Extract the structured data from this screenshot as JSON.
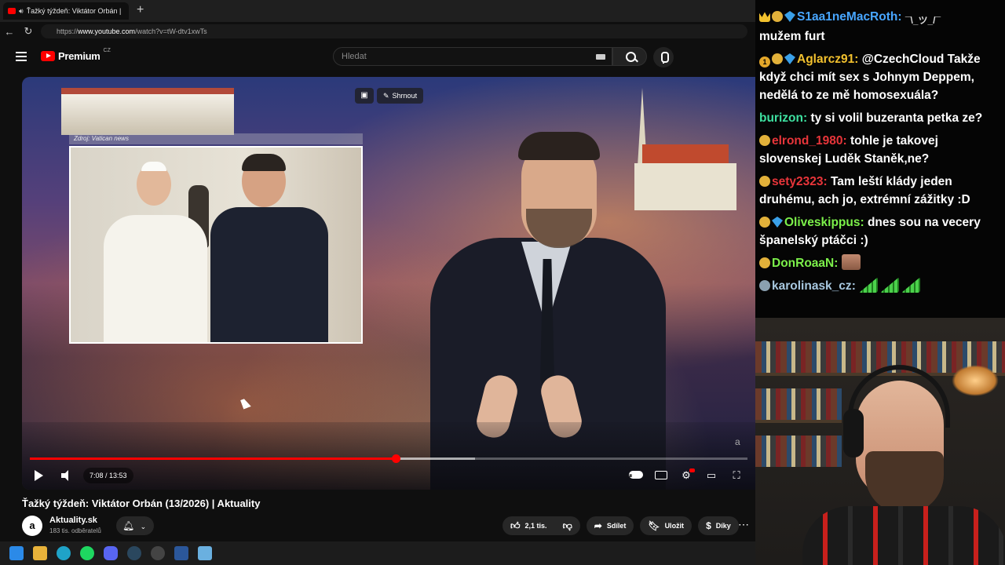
{
  "browser": {
    "tab_title": "Ťažký týždeň: Viktátor Orbán |",
    "url_prefix": "https://",
    "url_domain": "www.youtube.com",
    "url_path": "/watch?v=tW-dtv1xwTs"
  },
  "youtube": {
    "logo_text": "Premium",
    "logo_region": "CZ",
    "search_placeholder": "Hledat"
  },
  "player": {
    "summary_label": "Shrnout",
    "inset_source": "Zdroj: Vatican news",
    "current_time": "7:08",
    "duration": "13:53",
    "time_display": "7:08 / 13:53",
    "progress_fraction": 0.51,
    "buffer_fraction": 0.62,
    "watermark": "a"
  },
  "video": {
    "title": "Ťažký týždeň: Viktátor Orbán (13/2026) | Aktuality",
    "channel_name": "Aktuality.sk",
    "channel_initial": "a",
    "subscribers": "183 tis. odběratelů",
    "likes": "2,1 tis.",
    "share_label": "Sdílet",
    "save_label": "Uložit",
    "thanks_label": "Díky"
  },
  "chat": {
    "messages": [
      {
        "user": "S1aa1neMacRoth",
        "color": "#48a6ff",
        "badges": [
          "crown",
          "hand",
          "gem"
        ],
        "text": "mužem furt",
        "emote": "shrug"
      },
      {
        "user": "Aglarcz91",
        "color": "#f2c12e",
        "badges": [
          "coin",
          "hand",
          "gem"
        ],
        "text": "@CzechCloud Takže když chci mít sex s Johnym Deppem, nedělá to ze mě homosexuála?"
      },
      {
        "user": "burizon",
        "color": "#3ee0a0",
        "badges": [],
        "text": "ty si volil buzeranta petka ze?"
      },
      {
        "user": "elrond_1980",
        "color": "#e8353a",
        "badges": [
          "hand"
        ],
        "text": "tohle je takovej slovenskej Luděk Staněk,ne?"
      },
      {
        "user": "sety2323",
        "color": "#e8353a",
        "badges": [
          "hand"
        ],
        "text": "Tam leští klády jeden druhému, ach jo, extrémní zážitky :D"
      },
      {
        "user": "Oliveskippus",
        "color": "#7cf04a",
        "badges": [
          "hand",
          "gem"
        ],
        "text": "dnes sou na vecery španelský ptáčci :)"
      },
      {
        "user": "DonRoaaN",
        "color": "#7cf04a",
        "badges": [
          "hand"
        ],
        "text": "",
        "emote": "face"
      },
      {
        "user": "karolinask_cz",
        "color": "#a8c8e0",
        "badges": [
          "grey"
        ],
        "text": "",
        "emote": "bars3"
      }
    ],
    "emote_shrug_text": "¯\\_ツ_/¯"
  },
  "colors": {
    "progress_red": "#ff0000",
    "background": "#0f0f0f",
    "pill_bg": "#272727"
  }
}
